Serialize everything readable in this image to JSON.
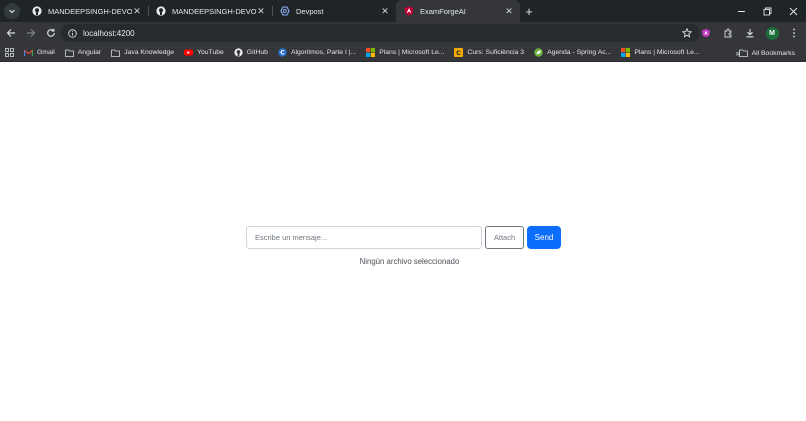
{
  "tabs": [
    {
      "title": "MANDEEPSINGH-DEVOPS/Exam",
      "icon": "github-icon",
      "active": false
    },
    {
      "title": "MANDEEPSINGH-DEVOPS/Exam",
      "icon": "github-icon",
      "active": false
    },
    {
      "title": "Devpost",
      "icon": "devpost-icon",
      "active": false
    },
    {
      "title": "ExamForgeAI",
      "icon": "angular-icon",
      "active": true
    }
  ],
  "toolbar": {
    "url": "localhost:4200",
    "profile_initial": "M"
  },
  "bookmarks": [
    {
      "label": "Gmail",
      "icon": "gmail-icon"
    },
    {
      "label": "Angular",
      "icon": "folder-icon"
    },
    {
      "label": "Java Knowledge",
      "icon": "folder-icon"
    },
    {
      "label": "YouTube",
      "icon": "youtube-icon"
    },
    {
      "label": "GitHub",
      "icon": "github-icon"
    },
    {
      "label": "Algoritmos, Parte I |...",
      "icon": "coursera-icon"
    },
    {
      "label": "Plans | Microsoft Le...",
      "icon": "microsoft-icon"
    },
    {
      "label": "Curs: Suficiència 3",
      "icon": "course-icon"
    },
    {
      "label": "Agenda - Spring Ac...",
      "icon": "spring-icon"
    },
    {
      "label": "Plans | Microsoft Le...",
      "icon": "microsoft-icon"
    }
  ],
  "all_bookmarks_label": "All Bookmarks",
  "chat": {
    "placeholder": "Escribe un mensaje...",
    "attach_label": "Attach",
    "send_label": "Send",
    "file_status": "Ningún archivo seleccionado"
  },
  "colors": {
    "accent": "#0d6efd",
    "chrome_dark": "#35363a",
    "tabstrip": "#1f2427"
  }
}
